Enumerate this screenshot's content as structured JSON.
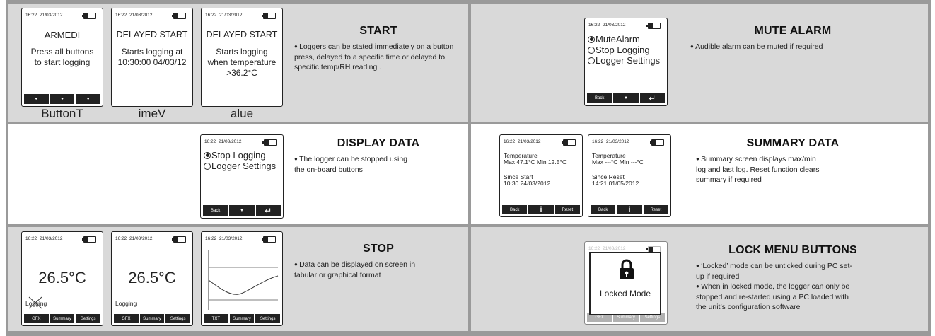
{
  "status": {
    "time": "16:22",
    "date": "21/03/2012"
  },
  "start_panel": {
    "title": "START",
    "description": "Loggers can be stated immediately on a button press, delayed to a specific time or delayed to specific temp/RH reading .",
    "screens": [
      {
        "heading": "ARMEDI",
        "body_l1": "Press all buttons",
        "body_l2": "to start logging",
        "caption": "ButtonT"
      },
      {
        "heading": "DELAYED START",
        "body_l1": "Starts logging at",
        "body_l2": "10:30:00 04/03/12",
        "caption": "imeV"
      },
      {
        "heading": "DELAYED START",
        "body_l1": "Starts logging",
        "body_l2": "when temperature",
        "body_l3": ">36.2°C",
        "caption": "alue"
      }
    ]
  },
  "mute_panel": {
    "title": "MUTE ALARM",
    "description": "Audible alarm can be muted if required",
    "menu": [
      "MuteAlarm",
      "Stop Logging",
      "Logger Settings"
    ],
    "buttons": [
      "Back"
    ]
  },
  "display_panel": {
    "title": "DISPLAY DATA",
    "description_l1": "The logger can be stopped using",
    "description_l2": "the on-board buttons",
    "menu": [
      "Stop Logging",
      "Logger Settings"
    ],
    "buttons": [
      "Back"
    ]
  },
  "summary_panel": {
    "title": "SUMMARY DATA",
    "description_l1": "Summary screen displays max/min",
    "description_l2": "log and last log. Reset function clears",
    "description_l3": "summary if required",
    "screens": [
      {
        "label": "Temperature",
        "maxmin": "Max 47.1°C  Min 12.5°C",
        "since": "Since Start",
        "stamp": "10:30  24/03/2012"
      },
      {
        "label": "Temperature",
        "maxmin": "Max ---°C  Min ---°C",
        "since": "Since Reset",
        "stamp": "14:21  01/05/2012"
      }
    ],
    "buttons": [
      "Back",
      "i",
      "Reset"
    ]
  },
  "stop_panel": {
    "title": "STOP",
    "description_l1": "Data can be displayed on screen in",
    "description_l2": "tabular or graphical format",
    "screens": [
      {
        "reading": "26.5°C",
        "status": "Logging",
        "buttons": [
          "GFX",
          "Summary",
          "Settings"
        ]
      },
      {
        "reading": "26.5°C",
        "status": "Logging",
        "buttons": [
          "GFX",
          "Summary",
          "Settings"
        ]
      },
      {
        "buttons": [
          "TXT",
          "Summary",
          "Settings"
        ]
      }
    ]
  },
  "lock_panel": {
    "title": "LOCK MENU BUTTONS",
    "bullet1_l1": "‘Locked’ mode can be unticked during PC set-",
    "bullet1_l2": "up if required",
    "bullet2_l1": "When in locked mode, the logger can only be",
    "bullet2_l2": "stopped and re-started using  a PC loaded with",
    "bullet2_l3": "the unit’s configuration software",
    "screen_label": "Locked Mode",
    "faded_buttons": [
      "GFX",
      "Summary",
      "Settings"
    ]
  }
}
